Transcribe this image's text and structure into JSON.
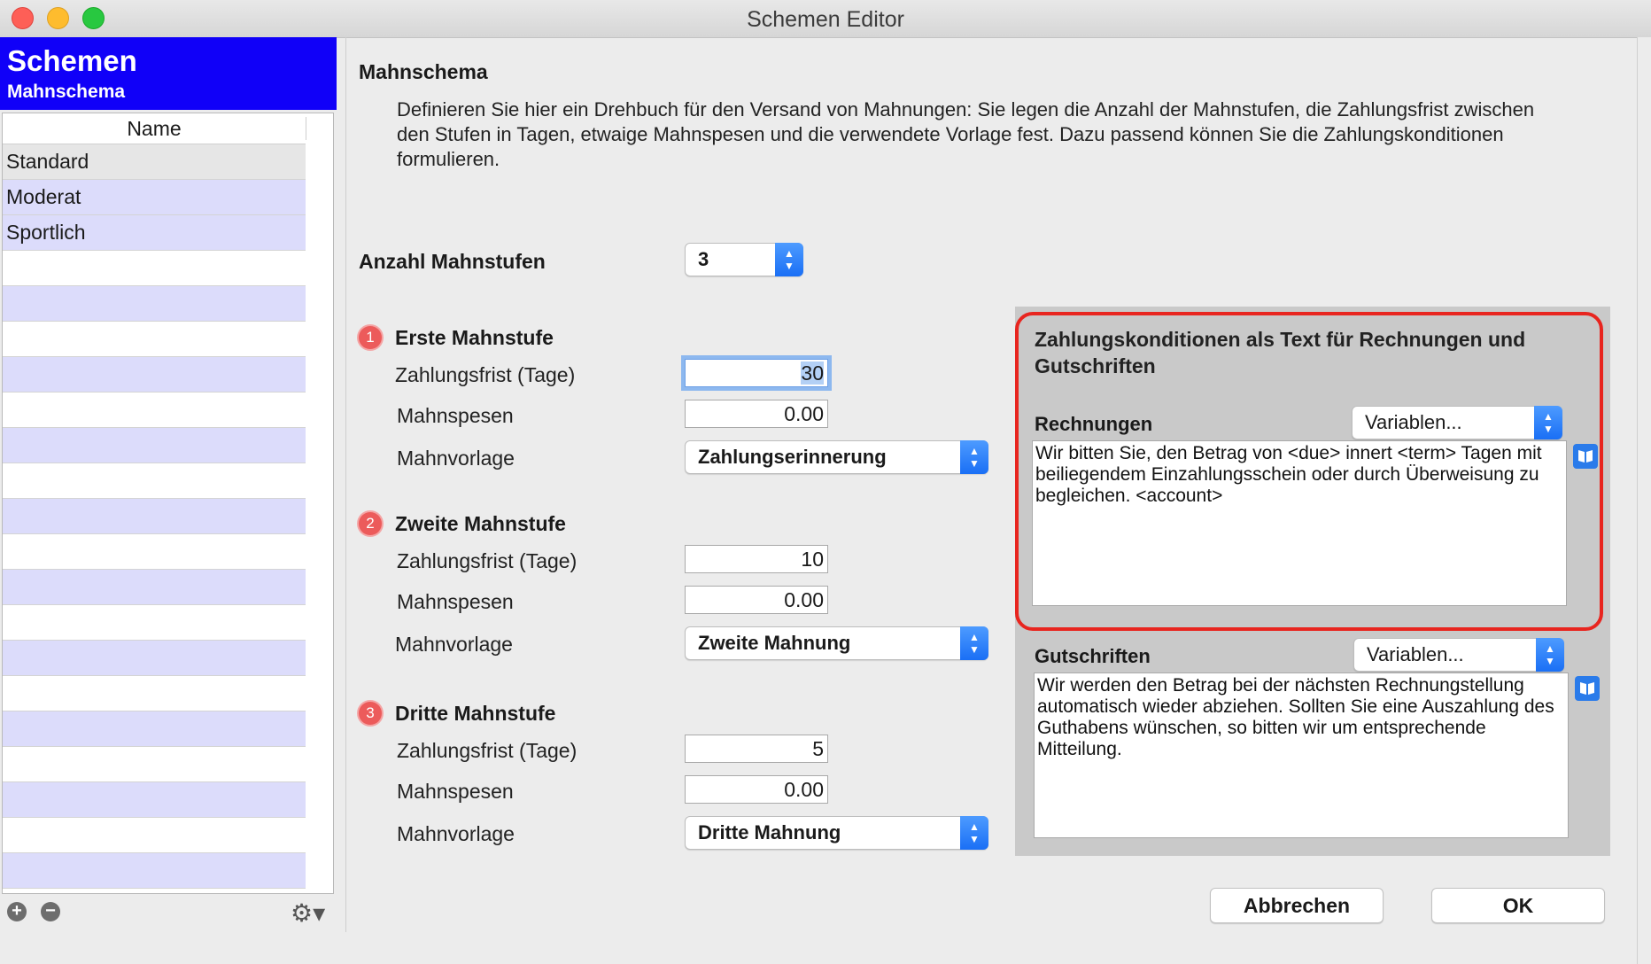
{
  "window": {
    "title": "Schemen Editor"
  },
  "sidebar": {
    "header_title": "Schemen",
    "header_subtitle": "Mahnschema",
    "column_header": "Name",
    "items": [
      {
        "label": "Standard"
      },
      {
        "label": "Moderat"
      },
      {
        "label": "Sportlich"
      }
    ],
    "footer": {
      "add": "+",
      "remove": "−",
      "gear": "⚙▾"
    }
  },
  "main": {
    "section_title": "Mahnschema",
    "description": "Definieren Sie hier ein Drehbuch für den Versand von Mahnungen: Sie legen die Anzahl der Mahnstufen, die Zahlungsfrist zwischen den Stufen in Tagen, etwaige Mahnspesen und die verwendete Vorlage fest. Dazu passend können Sie die Zahlungskonditionen formulieren.",
    "anzahl_label": "Anzahl Mahnstufen",
    "anzahl_value": "3",
    "stages": [
      {
        "number": "1",
        "title": "Erste Mahnstufe",
        "frist_label": "Zahlungsfrist (Tage)",
        "frist": "30",
        "spesen_label": "Mahnspesen",
        "spesen": "0.00",
        "vorlage_label": "Mahnvorlage",
        "vorlage": "Zahlungserinnerung"
      },
      {
        "number": "2",
        "title": "Zweite Mahnstufe",
        "frist_label": "Zahlungsfrist (Tage)",
        "frist": "10",
        "spesen_label": "Mahnspesen",
        "spesen": "0.00",
        "vorlage_label": "Mahnvorlage",
        "vorlage": "Zweite Mahnung"
      },
      {
        "number": "3",
        "title": "Dritte Mahnstufe",
        "frist_label": "Zahlungsfrist (Tage)",
        "frist": "5",
        "spesen_label": "Mahnspesen",
        "spesen": "0.00",
        "vorlage_label": "Mahnvorlage",
        "vorlage": "Dritte Mahnung"
      }
    ]
  },
  "panel": {
    "title": "Zahlungskonditionen als Text für Rechnungen und Gutschriften",
    "rechnungen_label": "Rechnungen",
    "rechnungen_variables": "Variablen...",
    "rechnungen_text": "Wir bitten Sie, den Betrag von <due> innert <term> Tagen mit beiliegendem Einzahlungsschein oder durch Überweisung zu begleichen. <account>",
    "gutschriften_label": "Gutschriften",
    "gutschriften_variables": "Variablen...",
    "gutschriften_text": "Wir werden den Betrag bei der nächsten Rechnungstellung automatisch wieder abziehen. Sollten Sie eine Auszahlung des Guthabens wünschen, so bitten wir um entsprechende Mitteilung.",
    "highlight_color": "#e8251f"
  },
  "buttons": {
    "cancel": "Abbrechen",
    "ok": "OK"
  }
}
